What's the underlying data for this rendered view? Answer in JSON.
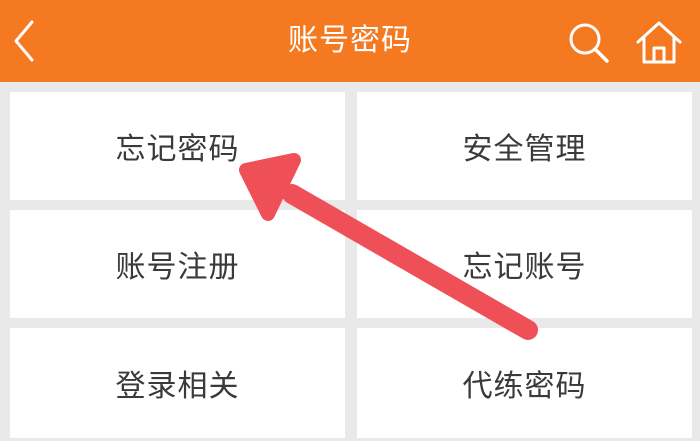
{
  "header": {
    "title": "账号密码",
    "back_icon": "chevron-left-icon",
    "search_icon": "search-icon",
    "home_icon": "home-icon",
    "background_color": "#f47920"
  },
  "grid": {
    "items": [
      {
        "label": "忘记密码"
      },
      {
        "label": "安全管理"
      },
      {
        "label": "账号注册"
      },
      {
        "label": "忘记账号"
      },
      {
        "label": "登录相关"
      },
      {
        "label": "代练密码"
      }
    ]
  },
  "annotation": {
    "arrow_color": "#ef4f56",
    "arrow_icon": "annotation-arrow-icon"
  }
}
